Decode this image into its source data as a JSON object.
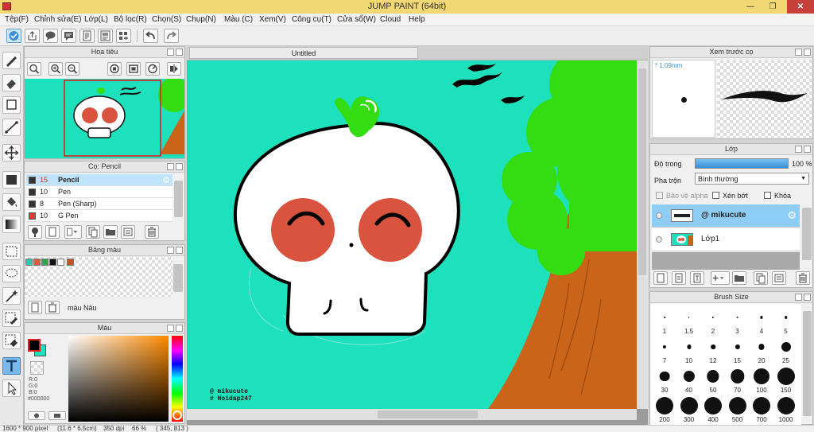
{
  "app": {
    "title": "JUMP PAINT (64bit)"
  },
  "menu": [
    "Tệp(F)",
    "Chỉnh sửa(E)",
    "Lớp(L)",
    "Bộ lọc(R)",
    "Chọn(S)",
    "Chụp(N)",
    "Màu (C)",
    "Xem(V)",
    "Công cụ(T)",
    "Cửa sổ(W)",
    "Cloud",
    "Help"
  ],
  "navigator": {
    "title": "Hoa tiêu"
  },
  "document": {
    "tab": "Untitled",
    "signature_line1": "@ mikucute",
    "signature_line2": "# Hoidap247"
  },
  "brush_panel": {
    "title": "Cọ: Pencil",
    "items": [
      {
        "size": "15",
        "name": "Pencil",
        "color": "#333333"
      },
      {
        "size": "10",
        "name": "Pen",
        "color": "#333333"
      },
      {
        "size": "8",
        "name": "Pen (Sharp)",
        "color": "#333333"
      },
      {
        "size": "10",
        "name": "G Pen",
        "color": "#e53935"
      }
    ]
  },
  "palette_panel": {
    "title": "Bảng màu",
    "swatches": [
      "#2ec9b0",
      "#e05a40",
      "#2ea84a",
      "#111111",
      "#ffffff",
      "#c7521c"
    ],
    "selected_name": "màu Nâu"
  },
  "color_panel": {
    "title": "Màu",
    "r": "R:0",
    "g": "G:0",
    "b": "B:0",
    "hex": "#000000"
  },
  "brush_preview": {
    "title": "Xem trước cọ",
    "size": "1.09mm"
  },
  "layer_panel": {
    "title": "Lớp",
    "opacity_label": "Độ trong",
    "opacity_value": "100 %",
    "opacity": 1.0,
    "blend_label": "Pha trộn",
    "blend_value": "Bình thường",
    "protect_alpha": "Bảo vệ alpha",
    "clipping": "Xén bớt",
    "lock": "Khóa",
    "layers": [
      {
        "name": "@ mikucute",
        "selected": true
      },
      {
        "name": "Lớp1",
        "selected": false
      }
    ]
  },
  "brush_size": {
    "title": "Brush Size",
    "sizes": [
      "1",
      "1.5",
      "2",
      "3",
      "4",
      "5",
      "7",
      "10",
      "12",
      "15",
      "20",
      "25",
      "30",
      "40",
      "50",
      "70",
      "100",
      "150",
      "200",
      "300",
      "400",
      "500",
      "700",
      "1000"
    ]
  },
  "status": {
    "dimensions": "1600 * 900 pixel",
    "size_cm": "(11.6 * 6.5cm)",
    "dpi": "350 dpi",
    "zoom": "66 %",
    "cursor": "( 345, 813 )"
  },
  "colors": {
    "canvas_bg": "#1de0bc",
    "leaf_green": "#33dd11",
    "trunk_brown": "#c96418",
    "cheek_red": "#d9533f",
    "title_bar": "#f2d874",
    "selection_blue": "#8ecdf6"
  }
}
